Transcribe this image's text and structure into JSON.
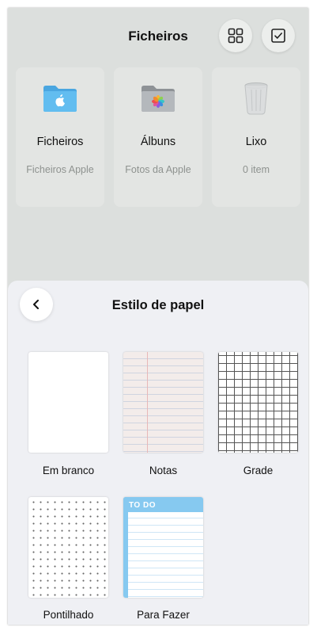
{
  "header": {
    "title": "Ficheiros"
  },
  "icons": {
    "grid": "grid-icon",
    "select": "checkbox-icon",
    "back": "chevron-left-icon"
  },
  "folders": [
    {
      "name": "Ficheiros",
      "subtitle": "Ficheiros Apple",
      "icon": "folder-icon"
    },
    {
      "name": "Álbuns",
      "subtitle": "Fotos da Apple",
      "icon": "photos-folder-icon"
    },
    {
      "name": "Lixo",
      "subtitle": "0 item",
      "icon": "trash-icon"
    }
  ],
  "sheet": {
    "title": "Estilo de papel",
    "papers": [
      {
        "label": "Em branco"
      },
      {
        "label": "Notas"
      },
      {
        "label": "Grade"
      },
      {
        "label": "Pontilhado"
      },
      {
        "label": "Para Fazer",
        "header": "TO DO"
      }
    ]
  },
  "colors": {
    "folder_blue": "#5db3e8",
    "todo_blue": "#86c9f0",
    "background_dim": "#dcdfdd",
    "sheet_bg": "#eff0f4"
  }
}
